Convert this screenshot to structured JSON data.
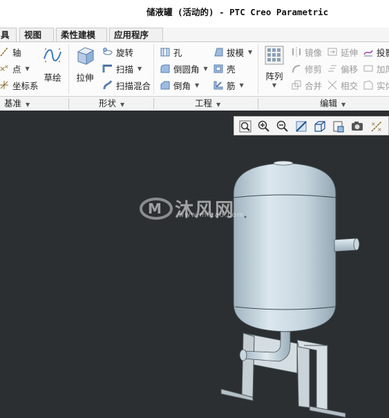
{
  "window": {
    "title": "储液罐 (活动的) - PTC Creo Parametric"
  },
  "menu": {
    "tabs": [
      "具",
      "视图",
      "柔性建模",
      "应用程序"
    ]
  },
  "ribbon": {
    "datum": {
      "axis": "轴",
      "point": "点",
      "csys": "坐标系",
      "sketch": "草绘"
    },
    "shapes": {
      "extrude": "拉伸",
      "revolve": "旋转",
      "sweep": "扫描",
      "swept_blend": "扫描混合"
    },
    "engineering": {
      "hole": "孔",
      "round": "倒圆角",
      "chamfer": "倒角",
      "draft": "拔模",
      "shell": "壳",
      "rib": "筋"
    },
    "editing": {
      "pattern": "阵列",
      "mirror": "镜像",
      "trim": "修剪",
      "merge": "合并",
      "extend": "延伸",
      "offset": "偏移",
      "intersect": "相交",
      "project": "投影",
      "thicken": "加厚",
      "solidify": "实体"
    }
  },
  "groups": {
    "datum": "基准",
    "shapes": "形状",
    "engineering": "工程",
    "editing": "编辑"
  },
  "view_toolbar": {
    "icons": [
      "refit-icon",
      "zoom-in-icon",
      "zoom-out-icon",
      "repaint-icon",
      "view-orientation-icon",
      "saved-views-icon",
      "display-style-icon",
      "datum-display-icon"
    ]
  },
  "watermark": {
    "text": "沐风网",
    "url": "www.mfcad.com"
  },
  "colors": {
    "model": "#c8d7e0",
    "background": "#2b2f31",
    "bracket": "#c9d3d8"
  }
}
